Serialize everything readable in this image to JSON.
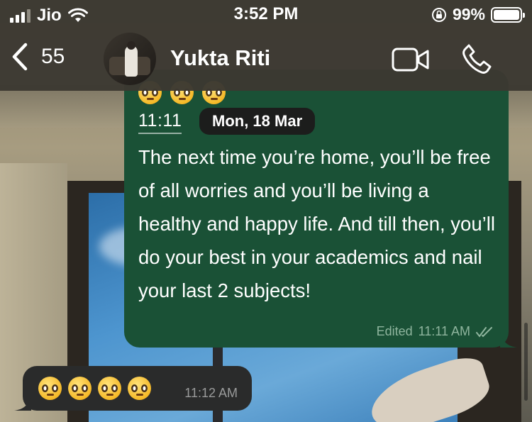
{
  "status_bar": {
    "carrier": "Jio",
    "time": "3:52 PM",
    "battery": "99%",
    "icons": [
      "signal-icon",
      "wifi-icon",
      "rotation-lock-icon",
      "battery-icon"
    ]
  },
  "header": {
    "back_count": "55",
    "contact_name": "Yukta Riti",
    "icons": [
      "chevron-left-icon",
      "avatar",
      "video-call-icon",
      "phone-icon"
    ]
  },
  "messages": [
    {
      "direction": "outgoing",
      "emoji": [
        "🥹",
        "🥹",
        "🥹"
      ],
      "quoted_time": "11:11",
      "date_chip": "Mon, 18 Mar",
      "text": "The next time you’re home, you’ll be free of all worries and you’ll be living a healthy and happy life. And till then, you’ll do your best in your academics and nail your last 2 subjects!",
      "edited_label": "Edited",
      "time": "11:11 AM",
      "status": "read"
    },
    {
      "direction": "incoming",
      "emoji": [
        "🥹",
        "🥹",
        "🥹",
        "🥹"
      ],
      "time": "11:12 AM"
    }
  ],
  "colors": {
    "outgoing_bubble": "#1a5136",
    "incoming_bubble": "#2a2b2b",
    "header_bg": "#3c3932"
  }
}
